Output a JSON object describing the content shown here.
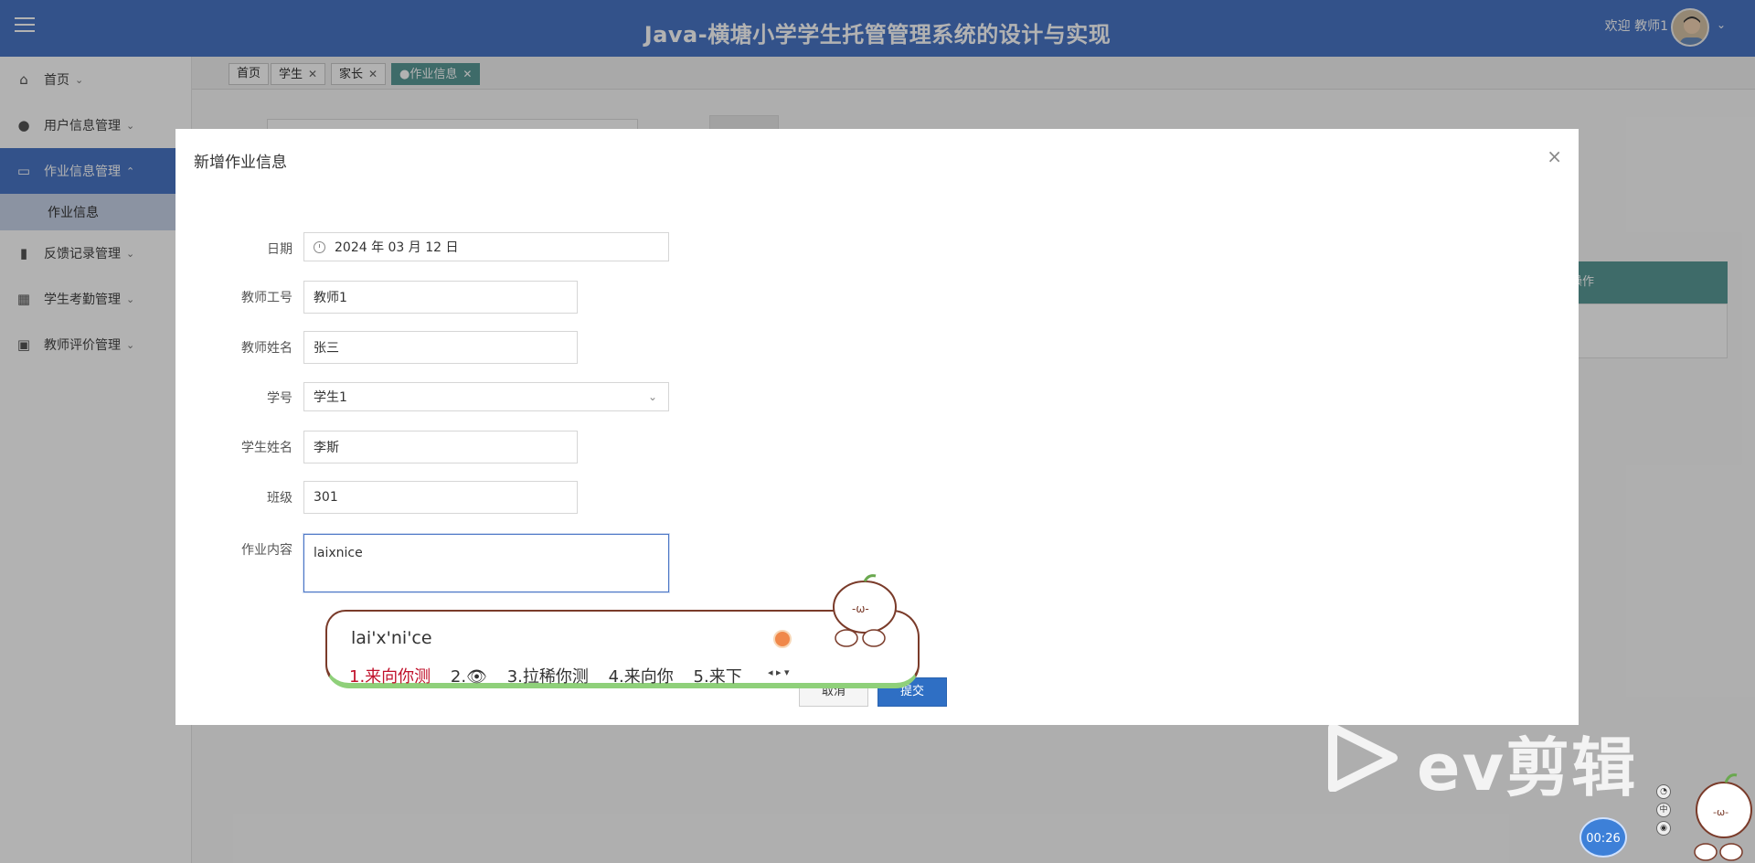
{
  "header": {
    "title": "Java-横塘小学学生托管管理系统的设计与实现",
    "welcome": "欢迎 教师1"
  },
  "sidebar": {
    "items": [
      {
        "label": "首页",
        "icon": "home-icon"
      },
      {
        "label": "用户信息管理",
        "icon": "user-icon"
      },
      {
        "label": "作业信息管理",
        "icon": "card-icon",
        "active": true
      },
      {
        "label": "反馈记录管理",
        "icon": "book-icon"
      },
      {
        "label": "学生考勤管理",
        "icon": "building-icon"
      },
      {
        "label": "教师评价管理",
        "icon": "chip-icon"
      }
    ],
    "sub_item": "作业信息"
  },
  "tabs": [
    {
      "label": "首页"
    },
    {
      "label": "学生"
    },
    {
      "label": "家长"
    },
    {
      "label": "●作业信息",
      "active": true
    }
  ],
  "background": {
    "table_header": "操作"
  },
  "modal": {
    "title": "新增作业信息",
    "fields": {
      "date": {
        "label": "日期",
        "value": "2024 年 03 月 12 日"
      },
      "teacher_id": {
        "label": "教师工号",
        "value": "教师1"
      },
      "teacher_name": {
        "label": "教师姓名",
        "value": "张三"
      },
      "student_id": {
        "label": "学号",
        "value": "学生1"
      },
      "student_name": {
        "label": "学生姓名",
        "value": "李斯"
      },
      "class": {
        "label": "班级",
        "value": "301"
      },
      "homework": {
        "label": "作业内容",
        "value": "laixnice"
      }
    },
    "cancel_label": "取消",
    "submit_label": "提交"
  },
  "ime": {
    "composition": "lai'x'ni'ce",
    "candidates": [
      "1.来向你测",
      "2.👁",
      "3.拉稀你测",
      "4.来向你",
      "5.来下"
    ]
  },
  "watermark": {
    "text": "ev剪辑",
    "timer": "00:26"
  },
  "colors": {
    "header": "#4a76c6",
    "active_tab": "#5a9a97",
    "submit": "#2f6fc4"
  }
}
